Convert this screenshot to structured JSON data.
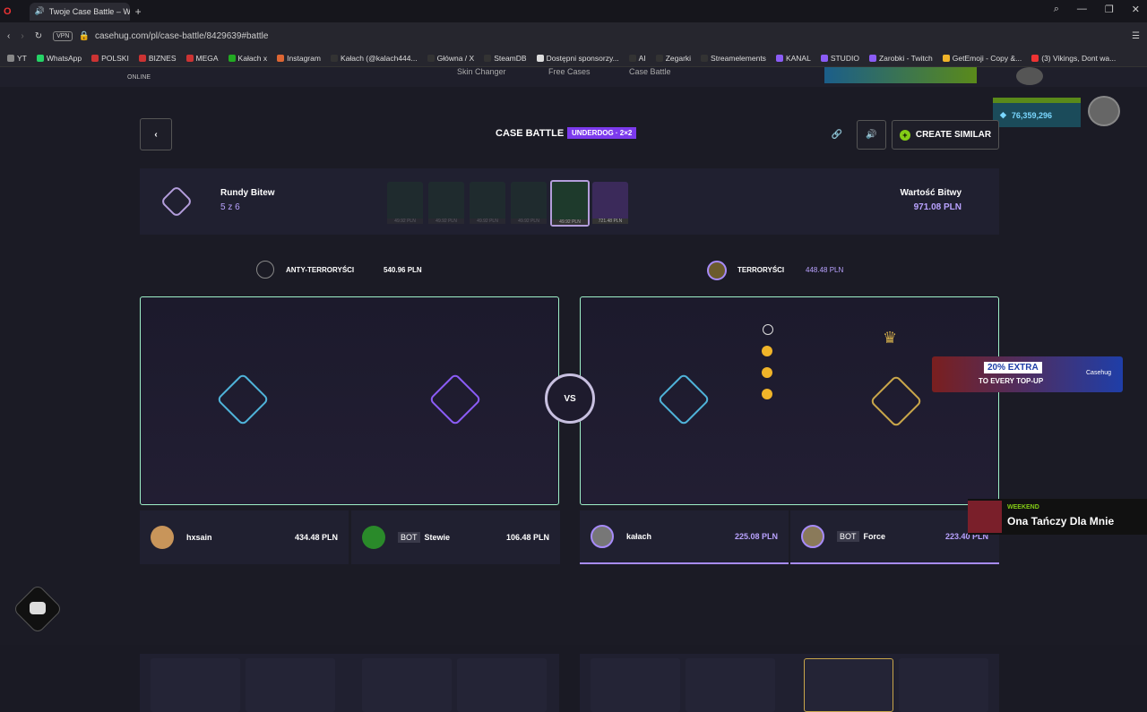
{
  "browser": {
    "tab_title": "Twoje Case Battle – W",
    "url": "casehug.com/pl/case-battle/8429639#battle",
    "vpn": "VPN"
  },
  "bookmarks": [
    "YT",
    "WhatsApp",
    "POLSKI",
    "BIZNES",
    "MEGA",
    "Kałach x",
    "Instagram",
    "Kałach (@kalach444...",
    "Główna / X",
    "SteamDB",
    "Dostępni sponsorzy...",
    "AI",
    "Zegarki",
    "Streamelements",
    "KANAL",
    "STUDIO",
    "Zarobki - Twitch",
    "GetEmoji - Copy &...",
    "(3) Vikings, Dont wa..."
  ],
  "site": {
    "online": "ONLINE",
    "nav": [
      "Skin Changer",
      "Free Cases",
      "Case Battle"
    ],
    "balance": "76,359,296"
  },
  "battle": {
    "title": "CASE BATTLE",
    "mode": "UNDERDOG · 2×2",
    "create": "CREATE SIMILAR",
    "rounds_label": "Rundy Bitew",
    "rounds_value": "5 z 6",
    "value_label": "Wartość Bitwy",
    "value": "971.08 PLN",
    "cases": [
      {
        "price": "49.92 PLN"
      },
      {
        "price": "49.92 PLN"
      },
      {
        "price": "49.92 PLN"
      },
      {
        "price": "49.92 PLN"
      },
      {
        "price": "49.92 PLN"
      },
      {
        "price": "721.48 PLN"
      }
    ]
  },
  "teams": {
    "ct": {
      "name": "ANTY-TERRORYŚCI",
      "value": "540.96 PLN"
    },
    "t": {
      "name": "TERRORYŚCI",
      "value": "448.48 PLN"
    }
  },
  "vs": "VS",
  "players": [
    {
      "name": "hxsain",
      "bot": "",
      "value": "434.48 PLN"
    },
    {
      "name": "Stewie",
      "bot": "BOT",
      "value": "106.48 PLN"
    },
    {
      "name": "kałach",
      "bot": "",
      "value": "225.08 PLN"
    },
    {
      "name": "Force",
      "bot": "BOT",
      "value": "223.40 PLN"
    }
  ],
  "promo": {
    "pct": "20% EXTRA",
    "sub": "TO EVERY TOP-UP",
    "brand": "Casehug"
  },
  "toast": {
    "tag": "WEEKEND",
    "title": "Ona Tańczy Dla Mnie"
  },
  "colors": {
    "accent": "#7c3aed",
    "mint": "#9ef0c8",
    "price": "#b9a2ff"
  }
}
